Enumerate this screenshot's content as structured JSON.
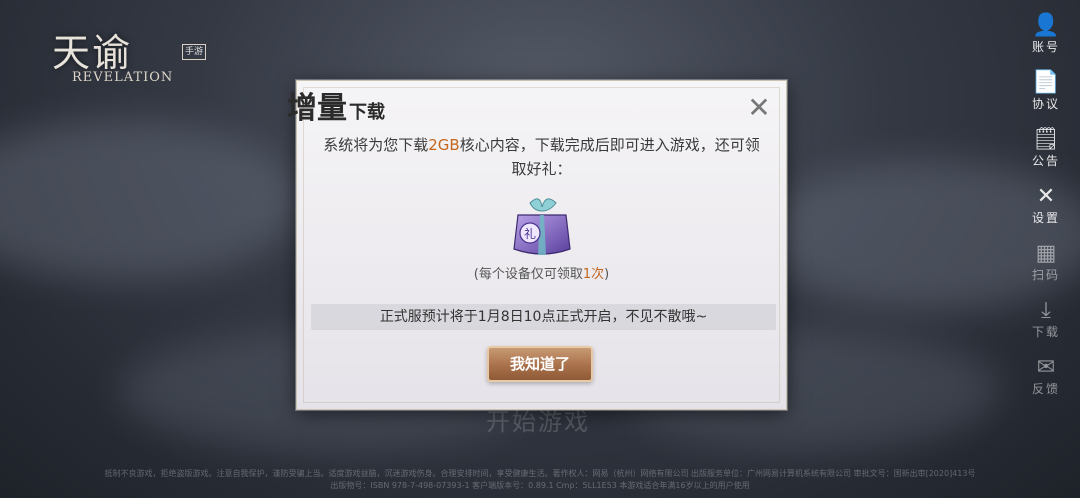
{
  "logo": {
    "title_cn": "天谕",
    "title_en": "REVELATION",
    "badge": "手游"
  },
  "nav": [
    {
      "icon": "account-icon",
      "glyph": "👤",
      "label": "账号"
    },
    {
      "icon": "agreement-icon",
      "glyph": "📄",
      "label": "协议"
    },
    {
      "icon": "notice-icon",
      "glyph": "🗒",
      "label": "公告"
    },
    {
      "icon": "settings-icon",
      "glyph": "✕",
      "label": "设置"
    },
    {
      "icon": "qr-scan-icon",
      "glyph": "▦",
      "label": "扫码"
    },
    {
      "icon": "download-icon",
      "glyph": "⤓",
      "label": "下载"
    },
    {
      "icon": "feedback-icon",
      "glyph": "✉",
      "label": "反馈"
    }
  ],
  "start_game": "开始游戏",
  "dialog": {
    "title_big": "增量",
    "title_small": "下载",
    "text_before": "系统将为您下载",
    "text_size": "2GB",
    "text_after": "核心内容，下载完成后即可进入游戏，还可领取好礼：",
    "gift_glyph": "礼",
    "note_before": "(每个设备仅可领取",
    "note_count": "1次",
    "note_after": ")",
    "notice": "正式服预计将于1月8日10点正式开启，不见不散哦~",
    "ok_label": "我知道了",
    "close_glyph": "✕"
  },
  "footer": "抵制不良游戏，拒绝盗版游戏。注意自我保护，谨防受骗上当。适度游戏益脑，沉迷游戏伤身。合理安排时间，享受健康生活。著作权人：网易（杭州）网络有限公司 出版服务单位：广州网易计算机系统有限公司 审批文号：国新出审[2020]413号 出版物号：ISBN 978-7-498-07393-1 客户端版本号：0.89.1 Cmp：5LL1E53 本游戏适合年满16岁以上的用户使用"
}
